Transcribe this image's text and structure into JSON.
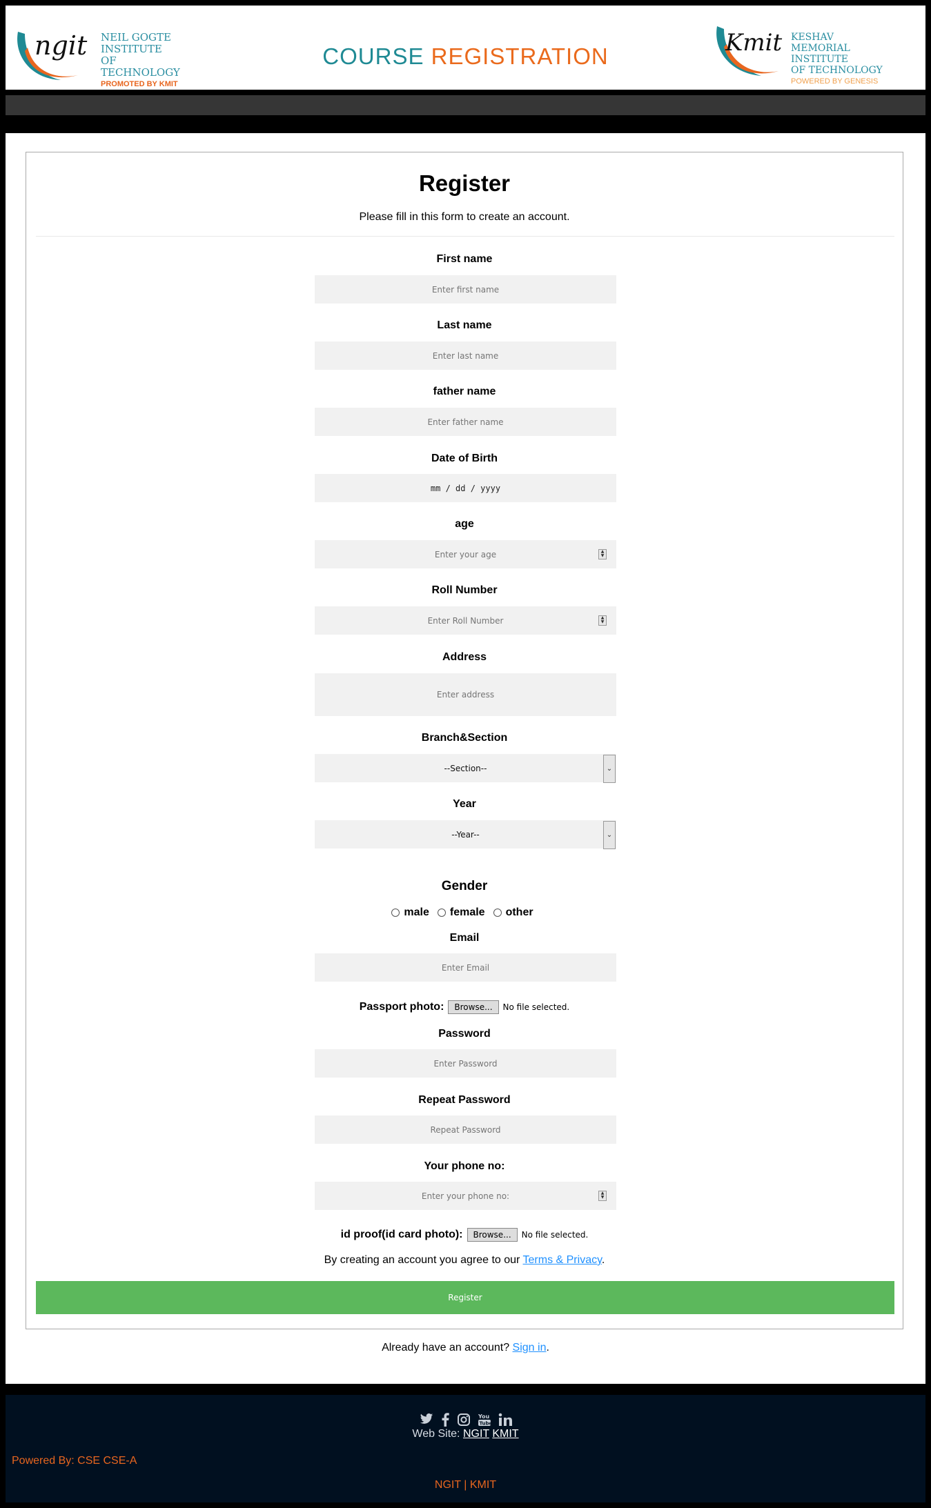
{
  "header": {
    "left_logo": {
      "mark": "ngit",
      "lines": [
        "NEIL GOGTE",
        "INSTITUTE OF",
        "TECHNOLOGY"
      ],
      "tag": "PROMOTED BY KMIT"
    },
    "title_a": "COURSE",
    "title_b": "REGISTRATION",
    "right_logo": {
      "mark": "Kmit",
      "lines": [
        "KESHAV",
        "MEMORIAL INSTITUTE",
        "OF TECHNOLOGY"
      ],
      "tag": "POWERED BY GENESIS"
    }
  },
  "form": {
    "heading": "Register",
    "intro": "Please fill in this form to create an account.",
    "first_name": {
      "label": "First name",
      "placeholder": "Enter first name"
    },
    "last_name": {
      "label": "Last name",
      "placeholder": "Enter last name"
    },
    "father_name": {
      "label": "father name",
      "placeholder": "Enter father name"
    },
    "dob": {
      "label": "Date of Birth",
      "placeholder": "mm / dd / yyyy"
    },
    "age": {
      "label": "age",
      "placeholder": "Enter your age"
    },
    "roll": {
      "label": "Roll Number",
      "placeholder": "Enter Roll Number"
    },
    "address": {
      "label": "Address",
      "placeholder": "Enter address"
    },
    "branch": {
      "label": "Branch&Section",
      "selected": "--Section--"
    },
    "year": {
      "label": "Year",
      "selected": "--Year--"
    },
    "gender": {
      "heading": "Gender",
      "options": [
        "male",
        "female",
        "other"
      ]
    },
    "email": {
      "label": "Email",
      "placeholder": "Enter Email"
    },
    "passport": {
      "label": "Passport photo:",
      "button": "Browse...",
      "status": "No file selected."
    },
    "password": {
      "label": "Password",
      "placeholder": "Enter Password"
    },
    "repeat": {
      "label": "Repeat Password",
      "placeholder": "Repeat Password"
    },
    "phone": {
      "label": "Your phone no:",
      "placeholder": "Enter your phone no:"
    },
    "idproof": {
      "label": "id proof(id card photo):",
      "button": "Browse...",
      "status": "No file selected."
    },
    "terms_prefix": "By creating an account you agree to our ",
    "terms_link": "Terms & Privacy",
    "terms_suffix": ".",
    "submit": "Register"
  },
  "signin": {
    "prefix": "Already have an account? ",
    "link": "Sign in",
    "suffix": "."
  },
  "footer": {
    "social": [
      "twitter",
      "facebook",
      "instagram",
      "youtube",
      "linkedin"
    ],
    "web_label": "Web Site:",
    "links": [
      "NGIT",
      "KMIT"
    ],
    "powered": "Powered By: CSE CSE-A",
    "bottom": "NGIT | KMIT"
  }
}
